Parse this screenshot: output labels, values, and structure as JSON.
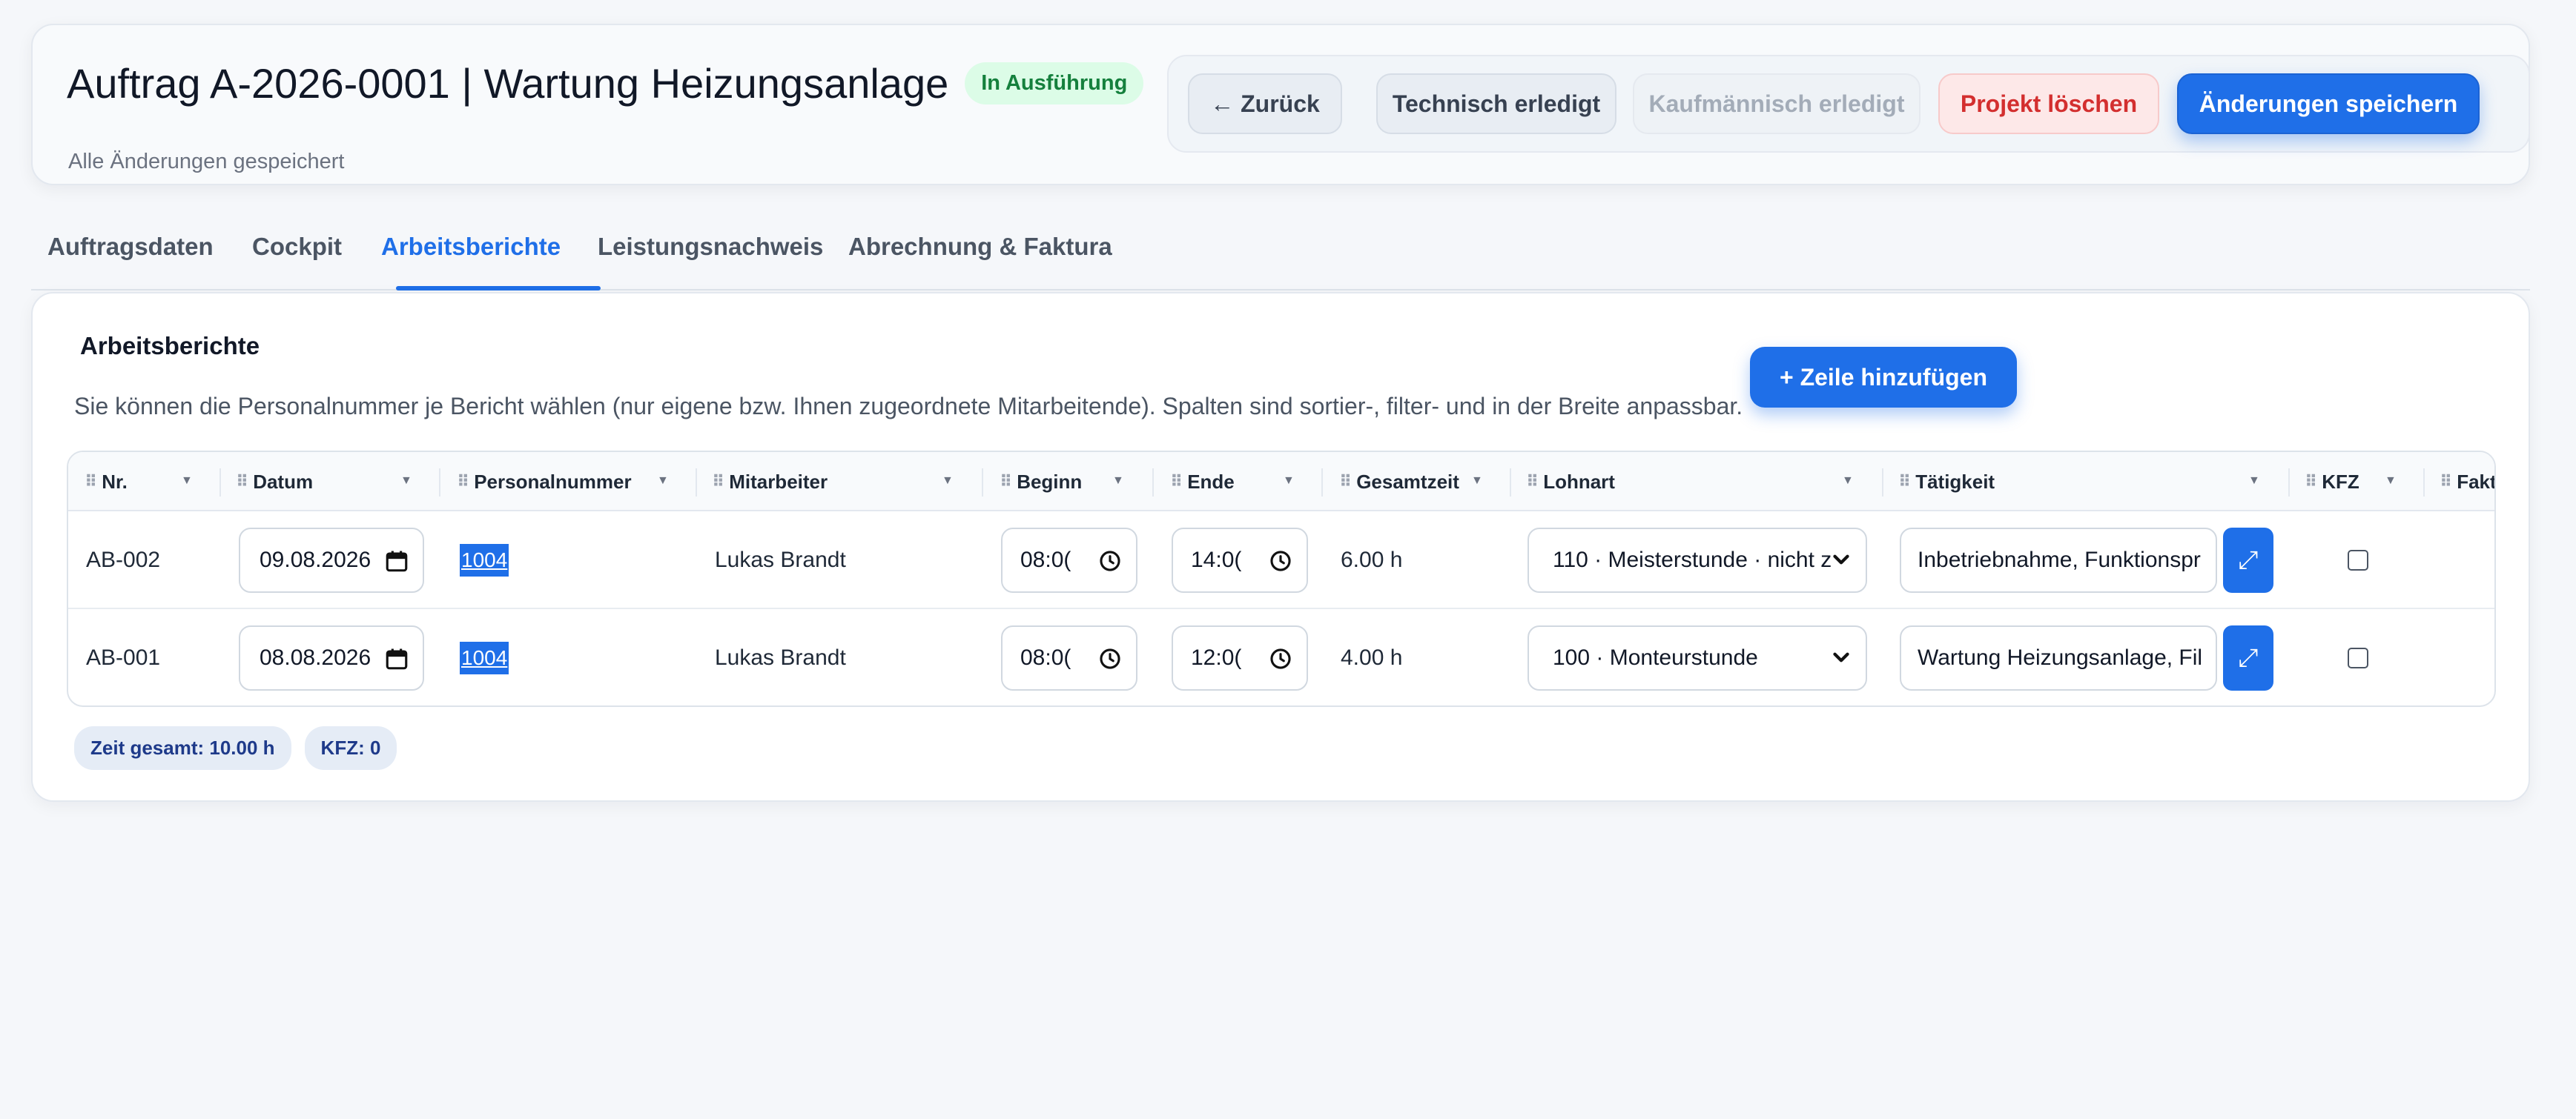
{
  "header": {
    "title": "Auftrag A-2026-0001 | Wartung Heizungsanlage",
    "status": "In Ausführung",
    "save_status": "Alle Änderungen gespeichert",
    "actions": {
      "back": "← Zurück",
      "technical_done": "Technisch erledigt",
      "commercial_done": "Kaufmännisch erledigt",
      "delete": "Projekt löschen",
      "save": "Änderungen speichern"
    }
  },
  "tabs": [
    {
      "label": "Auftragsdaten"
    },
    {
      "label": "Cockpit"
    },
    {
      "label": "Arbeitsberichte",
      "active": true
    },
    {
      "label": "Leistungsnachweis"
    },
    {
      "label": "Abrechnung & Faktura"
    }
  ],
  "section": {
    "title": "Arbeitsberichte",
    "description": "Sie können die Personalnummer je Bericht wählen (nur eigene bzw. Ihnen zugeordnete Mitarbeitende). Spalten sind sortier-, filter- und in der Breite anpassbar.",
    "add_row": "+ Zeile hinzufügen"
  },
  "table": {
    "columns": [
      "Nr.",
      "Datum",
      "Personalnummer",
      "Mitarbeiter",
      "Beginn",
      "Ende",
      "Gesamtzeit",
      "Lohnart",
      "Tätigkeit",
      "KFZ",
      "Fakt"
    ],
    "rows": [
      {
        "nr": "AB-002",
        "datum": "09.08.2026",
        "personalnummer": "1004",
        "mitarbeiter": "Lukas Brandt",
        "beginn": "08:0(",
        "ende": "14:0(",
        "gesamtzeit": "6.00 h",
        "lohnart": "110 · Meisterstunde · nicht z",
        "taetigkeit": "Inbetriebnahme, Funktionspr",
        "kfz": false
      },
      {
        "nr": "AB-001",
        "datum": "08.08.2026",
        "personalnummer": "1004",
        "mitarbeiter": "Lukas Brandt",
        "beginn": "08:0(",
        "ende": "12:0(",
        "gesamtzeit": "4.00 h",
        "lohnart": "100 · Monteurstunde",
        "taetigkeit": "Wartung Heizungsanlage, Fil",
        "kfz": false
      }
    ]
  },
  "summary": {
    "time_total": "Zeit gesamt: 10.00 h",
    "kfz": "KFZ: 0"
  },
  "colors": {
    "accent": "#1f6fe8",
    "status_green": "#15803d",
    "danger": "#d32f2f"
  }
}
